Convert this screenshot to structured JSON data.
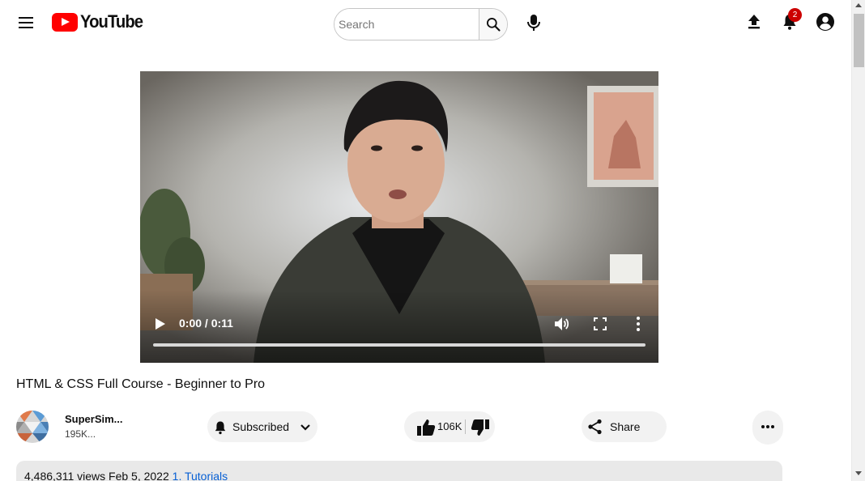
{
  "header": {
    "logo_text": "YouTube",
    "search_placeholder": "Search",
    "notification_count": "2",
    "icons": [
      "menu-icon",
      "youtube-logo-icon",
      "search-icon",
      "mic-icon",
      "upload-icon",
      "bell-icon",
      "account-icon"
    ]
  },
  "player": {
    "time": "0:00 / 0:11",
    "progress": 0,
    "icons": [
      "play-icon",
      "volume-icon",
      "fullscreen-icon",
      "more-vert-icon"
    ]
  },
  "video": {
    "title": "HTML & CSS Full Course - Beginner to Pro"
  },
  "channel": {
    "name": "SuperSim...",
    "subscribers": "195K..."
  },
  "actions": {
    "subscribe_label": "Subscribed",
    "like_count": "106K",
    "share_label": "Share"
  },
  "description": {
    "views": "4,486,311 views",
    "date": "Feb 5, 2022",
    "playlist": "1. Tutorials"
  },
  "colors": {
    "brand_red": "#ff0000",
    "badge_red": "#cc0000",
    "pill_bg": "#f2f2f2",
    "link_blue": "#065fd4"
  }
}
